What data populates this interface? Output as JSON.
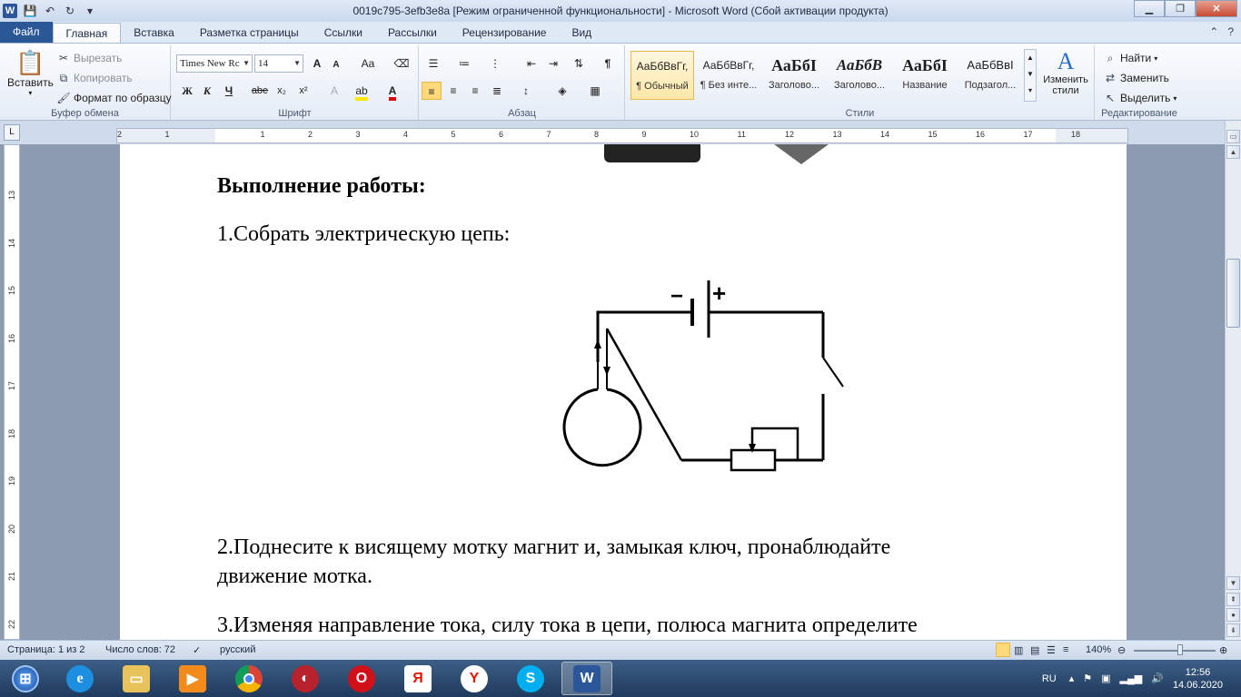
{
  "window": {
    "title": "0019c795-3efb3e8a [Режим ограниченной функциональности]  -  Microsoft Word (Сбой активации продукта)",
    "app_icon": "W"
  },
  "tabs": [
    "Файл",
    "Главная",
    "Вставка",
    "Разметка страницы",
    "Ссылки",
    "Рассылки",
    "Рецензирование",
    "Вид"
  ],
  "ribbon": {
    "clipboard": {
      "paste": "Вставить",
      "cut": "Вырезать",
      "copy": "Копировать",
      "format_painter": "Формат по образцу",
      "label": "Буфер обмена"
    },
    "font": {
      "font_name": "Times New Rc",
      "font_size": "14",
      "label": "Шрифт",
      "bold": "Ж",
      "italic": "К",
      "underline": "Ч",
      "strike": "abe",
      "sub": "x₂",
      "sup": "x²",
      "grow": "A",
      "shrink": "A",
      "case": "Aa"
    },
    "paragraph": {
      "label": "Абзац",
      "pilcrow": "¶"
    },
    "styles": {
      "label": "Стили",
      "items": [
        {
          "sample": "АаБбВвГг,",
          "name": "¶ Обычный"
        },
        {
          "sample": "АаБбВвГг,",
          "name": "¶ Без инте..."
        },
        {
          "sample": "АаБбІ",
          "name": "Заголово..."
        },
        {
          "sample": "АаБбВ",
          "name": "Заголово..."
        },
        {
          "sample": "АаБбІ",
          "name": "Название"
        },
        {
          "sample": "АаБбВвІ",
          "name": "Подзагол..."
        }
      ],
      "change_styles": "Изменить стили"
    },
    "editing": {
      "label": "Редактирование",
      "find": "Найти",
      "replace": "Заменить",
      "select": "Выделить"
    }
  },
  "ruler": {
    "h_ticks": [
      "2",
      "1",
      "1",
      "2",
      "3",
      "4",
      "5",
      "6",
      "7",
      "8",
      "9",
      "10",
      "11",
      "12",
      "13",
      "14",
      "15",
      "16",
      "17",
      "18"
    ],
    "v_ticks": [
      "13",
      "14",
      "15",
      "16",
      "17",
      "18",
      "19",
      "20",
      "21",
      "22"
    ]
  },
  "document": {
    "heading": "Выполнение работы:",
    "step1": "1.Собрать электрическую цепь:",
    "step2_line1": "2.Поднесите к висящему мотку магнит и, замыкая ключ, пронаблюдайте",
    "step2_line2": "движение мотка.",
    "step3_line1": "3.Изменяя направление тока, силу тока в цепи, полюса магнита определите",
    "minus": "−",
    "plus": "+"
  },
  "status": {
    "page": "Страница: 1 из 2",
    "words": "Число слов: 72",
    "language": "русский",
    "zoom": "140%"
  },
  "taskbar": {
    "lang": "RU",
    "time": "12:56",
    "date": "14.06.2020",
    "apps": [
      "start",
      "internet-explorer",
      "file-explorer",
      "media-player",
      "chrome",
      "speed-dial",
      "opera",
      "yandex-browser",
      "yandex",
      "skype",
      "word"
    ]
  }
}
